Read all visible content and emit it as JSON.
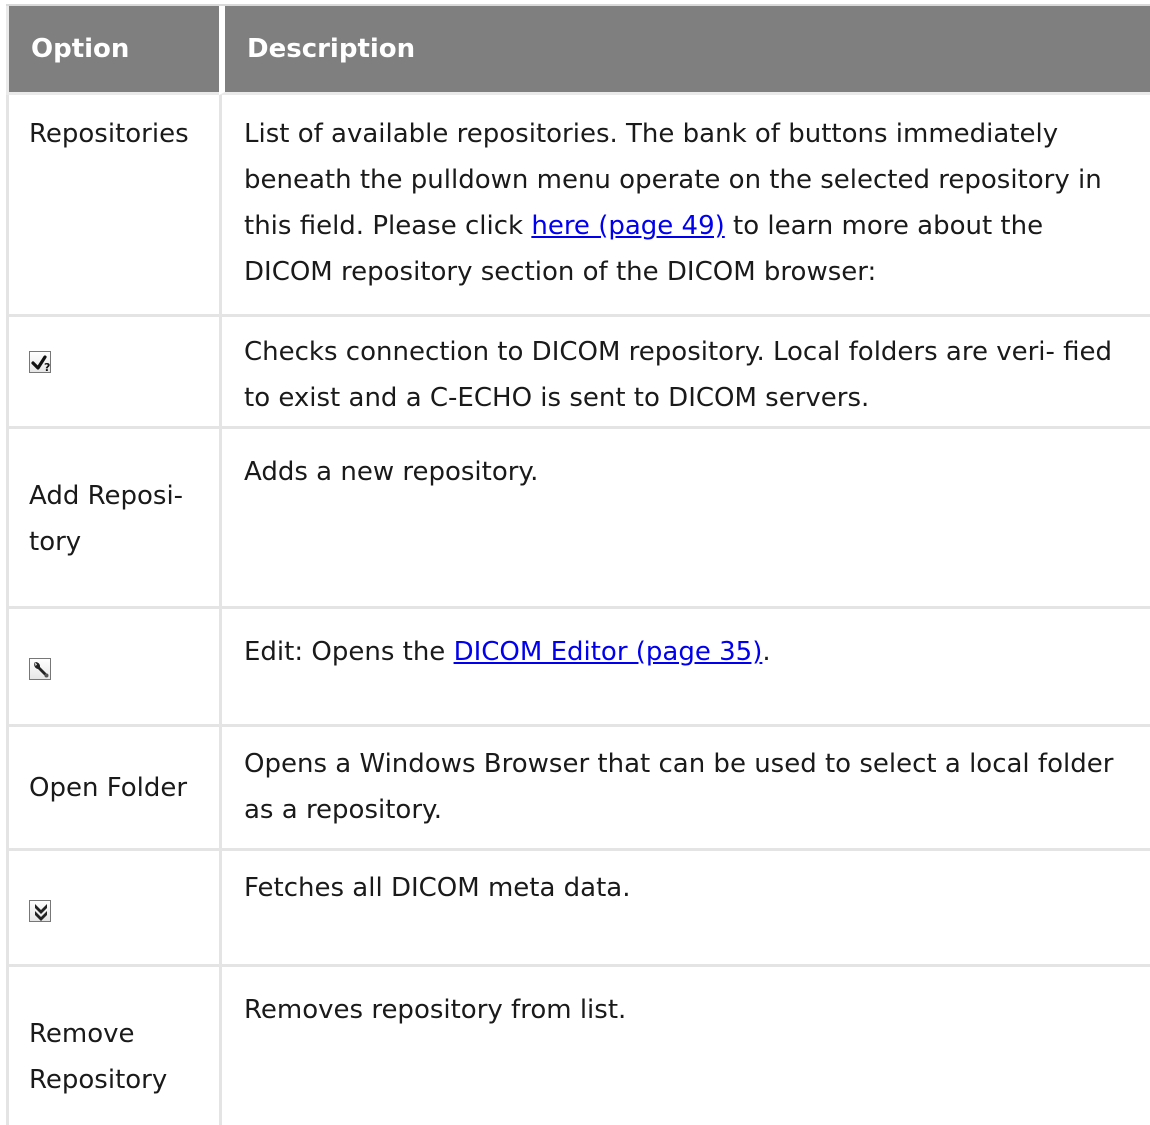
{
  "table": {
    "headers": {
      "option": "Option",
      "description": "Description"
    },
    "rows": [
      {
        "option": "Repositories",
        "description_parts": [
          "List of available repositories. The bank of buttons immediately beneath the pulldown menu operate on the selected repository in this field. Please click ",
          "here (page 49)",
          " to learn more about the DICOM repository section of the DICOM browser:"
        ]
      },
      {
        "option_icon": "check-question-icon",
        "description": "Checks connection to DICOM repository. Local folders are veri- fied to exist and a C-ECHO is sent to DICOM servers."
      },
      {
        "option_line1": "Add Reposi-",
        "option_line2": "tory",
        "description": "Adds a new repository."
      },
      {
        "option_icon": "wrench-icon",
        "description_parts": [
          "Edit: Opens the ",
          "DICOM Editor (page 35)",
          "."
        ]
      },
      {
        "option": "Open Folder",
        "description": "Opens a Windows Browser that can be used to select a local folder as a repository."
      },
      {
        "option_icon": "double-down-arrow-icon",
        "description": "Fetches all DICOM meta data."
      },
      {
        "option_line1": "Remove",
        "option_line2": "Repository",
        "description": "Removes repository from list."
      }
    ]
  },
  "colors": {
    "header_bg": "#7f7f7f",
    "header_text": "#ffffff",
    "link": "#0000ee",
    "border": "#e4e4e4"
  }
}
